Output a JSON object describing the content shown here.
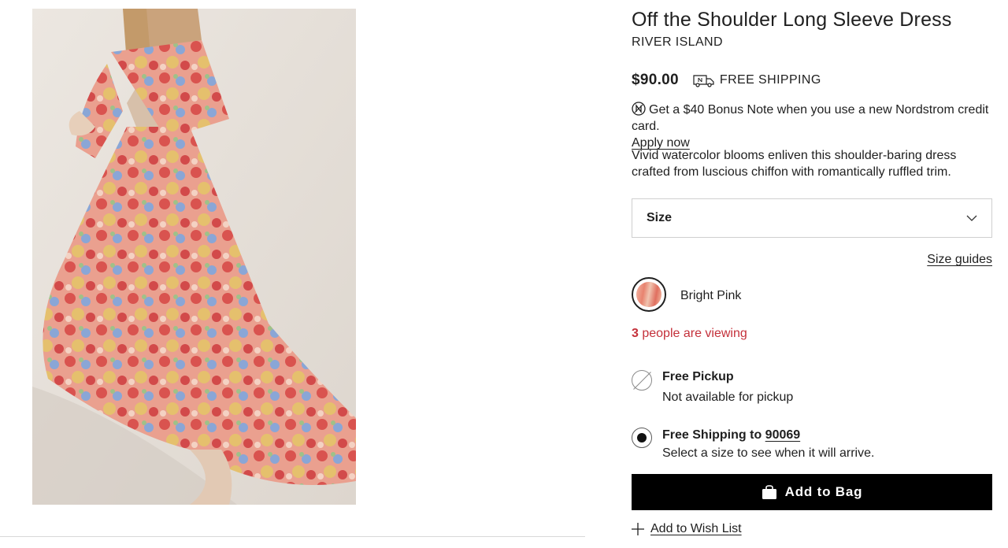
{
  "product": {
    "image_alt": "Off the Shoulder Long Sleeve Dress",
    "title": "Off the Shoulder Long Sleeve Dress",
    "brand": "RIVER ISLAND",
    "price": "$90.00",
    "shipping_badge": "FREE SHIPPING",
    "bonus_text": "Get a $40 Bonus Note when you use a new Nordstrom credit card.",
    "bonus_link": "Apply now",
    "description": "Vivid watercolor blooms enliven this shoulder-baring dress crafted from luscious chiffon with romantically ruffled trim."
  },
  "size_select": {
    "label": "Size"
  },
  "size_guides": "Size guides",
  "color": {
    "name": "Bright Pink"
  },
  "viewing": {
    "count": "3",
    "text": "people are viewing"
  },
  "fulfillment": {
    "pickup": {
      "title": "Free Pickup",
      "subtitle": "Not available for pickup"
    },
    "shipping": {
      "title_prefix": "Free Shipping to",
      "zip": "90069",
      "subtitle": "Select a size to see when it will arrive."
    }
  },
  "actions": {
    "add_to_bag": "Add to Bag",
    "add_to_wishlist": "Add to Wish List"
  },
  "icons": {
    "truck": "truck-icon",
    "bonus": "nordstrom-note-icon",
    "chevron": "chevron-down-icon",
    "bag": "shopping-bag-icon",
    "plus": "plus-icon"
  },
  "colors": {
    "viewing": "#c4303a",
    "button": "#000000"
  }
}
